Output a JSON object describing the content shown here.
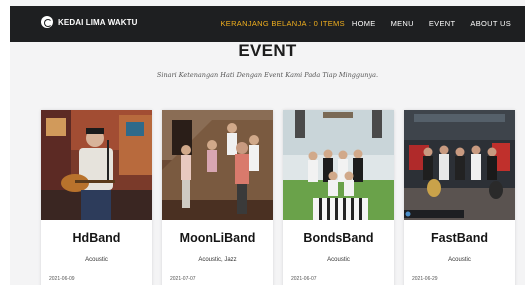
{
  "header": {
    "brand": "KEDAI LIMA WAKTU",
    "cart_label": "KERANJANG BELANJA : 0 ITEMS",
    "nav": [
      "HOME",
      "MENU",
      "EVENT",
      "ABOUT US"
    ],
    "accent_color": "#f2b01e",
    "bar_color": "#1e1f21"
  },
  "page": {
    "title": "EVENT",
    "subtitle": "Sinari Ketenangan Hati Dengan Event Kami Pada Tiap Minggunya."
  },
  "events": [
    {
      "name": "HdBand",
      "genre": "Acoustic",
      "date": "2021-06-09"
    },
    {
      "name": "MoonLiBand",
      "genre": "Acoustic, Jazz",
      "date": "2021-07-07"
    },
    {
      "name": "BondsBand",
      "genre": "Acoustic",
      "date": "2021-06-07"
    },
    {
      "name": "FastBand",
      "genre": "Acoustic",
      "date": "2021-06-29"
    }
  ]
}
